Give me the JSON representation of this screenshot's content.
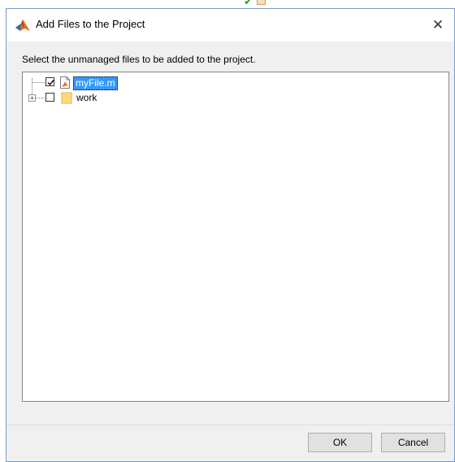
{
  "window": {
    "title": "Add Files to the Project",
    "close_glyph": "✕"
  },
  "prompt": "Select the unmanaged files to be added to the project.",
  "tree": {
    "items": [
      {
        "label": "myFile.m",
        "checked": true,
        "selected": true,
        "icon": "m-file-icon",
        "expandable": false
      },
      {
        "label": "work",
        "checked": false,
        "selected": false,
        "icon": "folder-icon",
        "expandable": true
      }
    ]
  },
  "buttons": {
    "ok_label": "OK",
    "cancel_label": "Cancel"
  },
  "colors": {
    "selection": "#3399ff",
    "dialog_bg": "#f0f0f0",
    "border_accent": "#7a9cc6"
  }
}
